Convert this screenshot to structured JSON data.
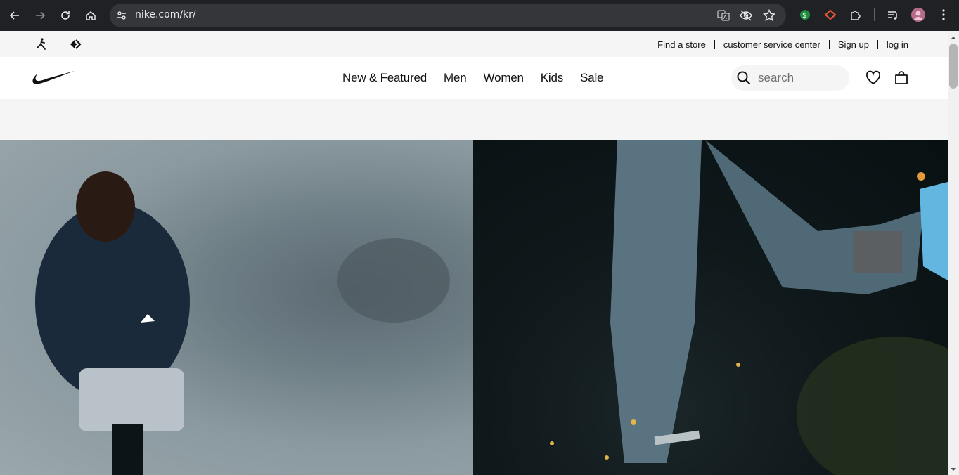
{
  "browser": {
    "url": "nike.com/kr/",
    "icons": [
      "back-icon",
      "forward-icon",
      "reload-icon",
      "home-icon",
      "site-info-icon",
      "translate-icon",
      "eye-off-icon",
      "star-icon",
      "extension-green-icon",
      "extension-red-icon",
      "puzzle-icon",
      "media-icon",
      "profile-avatar",
      "menu-dots-icon"
    ]
  },
  "utility_bar": {
    "brands": [
      "jordan-icon",
      "converse-icon"
    ],
    "links": [
      "Find a store",
      "customer service center",
      "Sign up",
      "log in"
    ]
  },
  "nav": {
    "logo": "nike-swoosh-icon",
    "menu": [
      "New & Featured",
      "Men",
      "Women",
      "Kids",
      "Sale"
    ],
    "search_placeholder": "search",
    "icons": [
      "heart-icon",
      "bag-icon"
    ]
  },
  "colors": {
    "chrome_bg": "#202124",
    "omnibox_bg": "#35363a",
    "utility_bg": "#f5f5f5",
    "text": "#111111"
  }
}
